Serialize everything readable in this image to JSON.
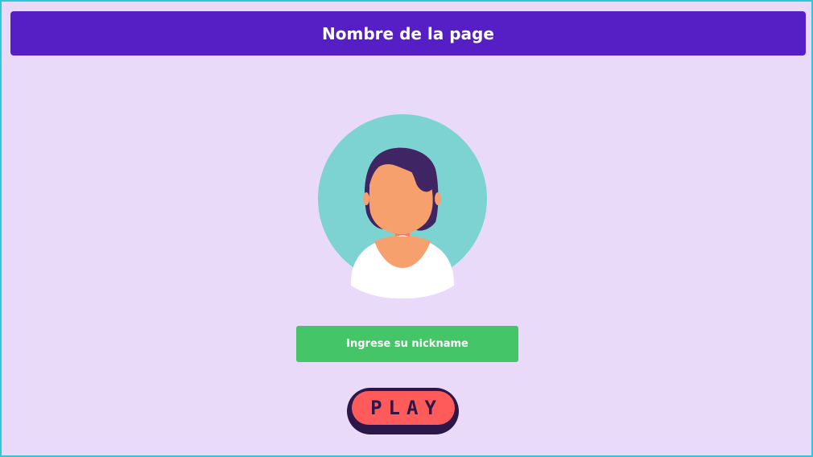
{
  "header": {
    "title": "Nombre de la page"
  },
  "avatar": {
    "icon": "avatar-icon"
  },
  "nickname": {
    "label": "Ingrese su nickname"
  },
  "play": {
    "label": "PLAY"
  },
  "colors": {
    "background": "#EADAF9",
    "border": "#2FC7D9",
    "header": "#561FC6",
    "nickname_button": "#44C568",
    "play_button": "#FF5B5B",
    "play_text": "#2D1749",
    "avatar_circle": "#7DD3D2",
    "avatar_hair": "#3F2563",
    "avatar_skin": "#F6A06D"
  }
}
